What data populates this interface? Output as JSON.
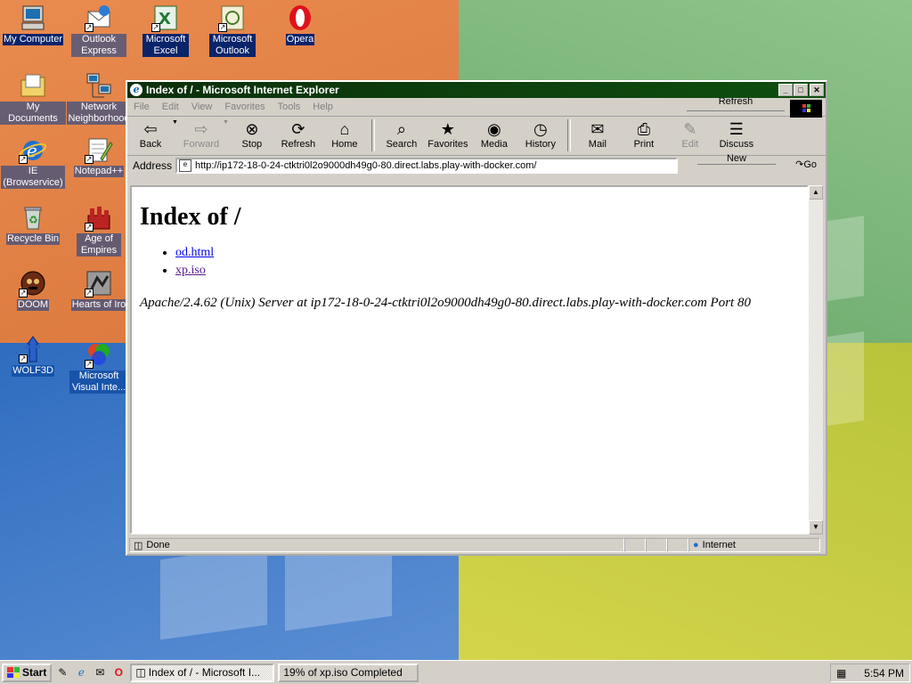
{
  "desktop": {
    "icons": [
      {
        "label": "My Computer",
        "icon": "my-computer-icon",
        "selected": true
      },
      {
        "label": "Outlook Express",
        "icon": "outlook-express-icon",
        "selected": false
      },
      {
        "label": "Microsoft Excel",
        "icon": "excel-icon",
        "selected": true
      },
      {
        "label": "Microsoft Outlook",
        "icon": "outlook-icon",
        "selected": true
      },
      {
        "label": "Opera",
        "icon": "opera-icon",
        "selected": true
      },
      {
        "label": "My Documents",
        "icon": "my-documents-icon",
        "selected": false
      },
      {
        "label": "Network Neighborhood",
        "icon": "network-neighborhood-icon",
        "selected": false
      },
      {
        "label": "IE (Browservice)",
        "icon": "internet-explorer-icon",
        "selected": false
      },
      {
        "label": "Notepad++",
        "icon": "notepad-plus-plus-icon",
        "selected": false
      },
      {
        "label": "Recycle Bin",
        "icon": "recycle-bin-icon",
        "selected": false
      },
      {
        "label": "Age of Empires",
        "icon": "age-of-empires-icon",
        "selected": false
      },
      {
        "label": "DOOM",
        "icon": "doom-icon",
        "selected": false
      },
      {
        "label": "Hearts of Iro",
        "icon": "hearts-of-iron-icon",
        "selected": false
      },
      {
        "label": "WOLF3D",
        "icon": "wolf3d-icon",
        "selected": false
      },
      {
        "label": "Microsoft Visual Inte...",
        "icon": "visual-interdev-icon",
        "selected": false
      }
    ]
  },
  "window": {
    "title": "Index of / - Microsoft Internet Explorer",
    "menu": [
      "File",
      "Edit",
      "View",
      "Favorites",
      "Tools",
      "Help"
    ],
    "refresh_float": "Refresh",
    "toolbar": {
      "back": "Back",
      "forward": "Forward",
      "stop": "Stop",
      "refresh": "Refresh",
      "home": "Home",
      "search": "Search",
      "favorites": "Favorites",
      "media": "Media",
      "history": "History",
      "mail": "Mail",
      "print": "Print",
      "edit": "Edit",
      "discuss": "Discuss"
    },
    "address": {
      "label": "Address",
      "url": "http://ip172-18-0-24-ctktri0l2o9000dh49g0-80.direct.labs.play-with-docker.com/",
      "new_label": "New",
      "go_label": "Go"
    },
    "page": {
      "heading": "Index of /",
      "links": [
        "od.html",
        "xp.iso"
      ],
      "footer": "Apache/2.4.62 (Unix) Server at ip172-18-0-24-ctktri0l2o9000dh49g0-80.direct.labs.play-with-docker.com Port 80"
    },
    "status": {
      "text": "Done",
      "zone": "Internet"
    }
  },
  "taskbar": {
    "start": "Start",
    "tasks": [
      "Index of / - Microsoft I...",
      "19% of xp.iso Completed"
    ],
    "clock": "5:54 PM"
  }
}
